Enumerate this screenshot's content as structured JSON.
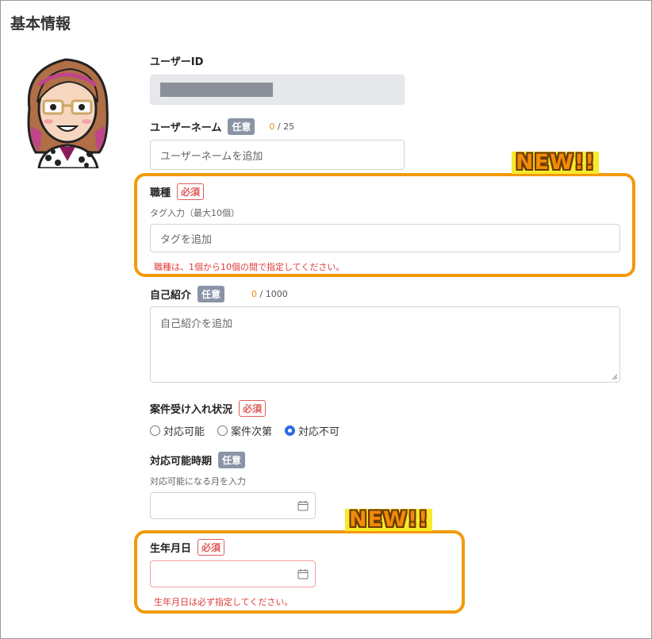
{
  "section": {
    "title": "基本情報"
  },
  "user_id": {
    "label": "ユーザーID"
  },
  "username": {
    "label": "ユーザーネーム",
    "badge": "任意",
    "count": "0",
    "max": "/ 25",
    "placeholder": "ユーザーネームを追加"
  },
  "job": {
    "label": "職種",
    "badge": "必須",
    "hint": "タグ入力（最大10個）",
    "placeholder": "タグを追加",
    "error": "職種は、1個から10個の間で指定してください。"
  },
  "bio": {
    "label": "自己紹介",
    "badge": "任意",
    "count": "0",
    "max": "/ 1000",
    "placeholder": "自己紹介を追加"
  },
  "availability": {
    "label": "案件受け入れ状況",
    "badge": "必須",
    "options": [
      {
        "label": "対応可能",
        "selected": false
      },
      {
        "label": "案件次第",
        "selected": false
      },
      {
        "label": "対応不可",
        "selected": true
      }
    ]
  },
  "available_from": {
    "label": "対応可能時期",
    "badge": "任意",
    "hint": "対応可能になる月を入力",
    "icon": "calendar-icon"
  },
  "birthday": {
    "label": "生年月日",
    "badge": "必須",
    "error": "生年月日は必ず指定してください。",
    "icon": "calendar-icon"
  },
  "highlights": {
    "new_label": "NEW!!",
    "accent": "#f29a0c",
    "badge_bg": "#f7e92b"
  },
  "colors": {
    "required": "#e05b5b",
    "optional_badge": "#8a94a6",
    "radio_on": "#2b6be4"
  }
}
